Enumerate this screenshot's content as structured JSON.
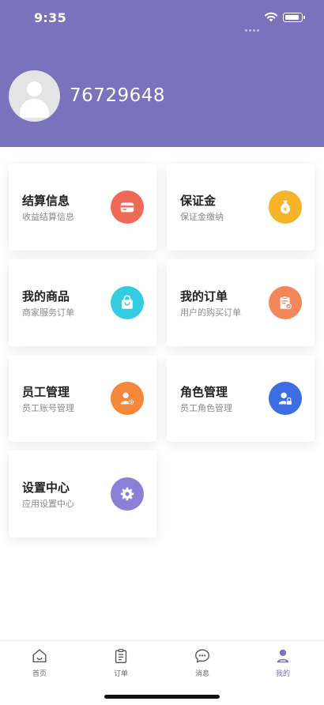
{
  "status_bar": {
    "time": "9:35"
  },
  "profile": {
    "user_id": "76729648"
  },
  "cards": [
    {
      "title": "结算信息",
      "subtitle": "收益结算信息",
      "icon": "card-payment-icon",
      "color": "#ee6a57"
    },
    {
      "title": "保证金",
      "subtitle": "保证金缴纳",
      "icon": "money-bag-icon",
      "color": "#f5b42a"
    },
    {
      "title": "我的商品",
      "subtitle": "商家服务订单",
      "icon": "shopping-bag-icon",
      "color": "#33cce0"
    },
    {
      "title": "我的订单",
      "subtitle": "用户的购买订单",
      "icon": "order-clipboard-icon",
      "color": "#f4875a"
    },
    {
      "title": "员工管理",
      "subtitle": "员工账号管理",
      "icon": "user-gear-icon",
      "color": "#f4873a"
    },
    {
      "title": "角色管理",
      "subtitle": "员工角色管理",
      "icon": "user-lock-icon",
      "color": "#3d6de3"
    },
    {
      "title": "设置中心",
      "subtitle": "应用设置中心",
      "icon": "gear-icon",
      "color": "#8a80d8"
    }
  ],
  "tabbar": {
    "items": [
      {
        "label": "首页",
        "icon": "home-icon"
      },
      {
        "label": "订单",
        "icon": "clipboard-icon"
      },
      {
        "label": "消息",
        "icon": "chat-bubble-icon"
      },
      {
        "label": "我的",
        "icon": "person-icon",
        "active": true
      }
    ]
  }
}
